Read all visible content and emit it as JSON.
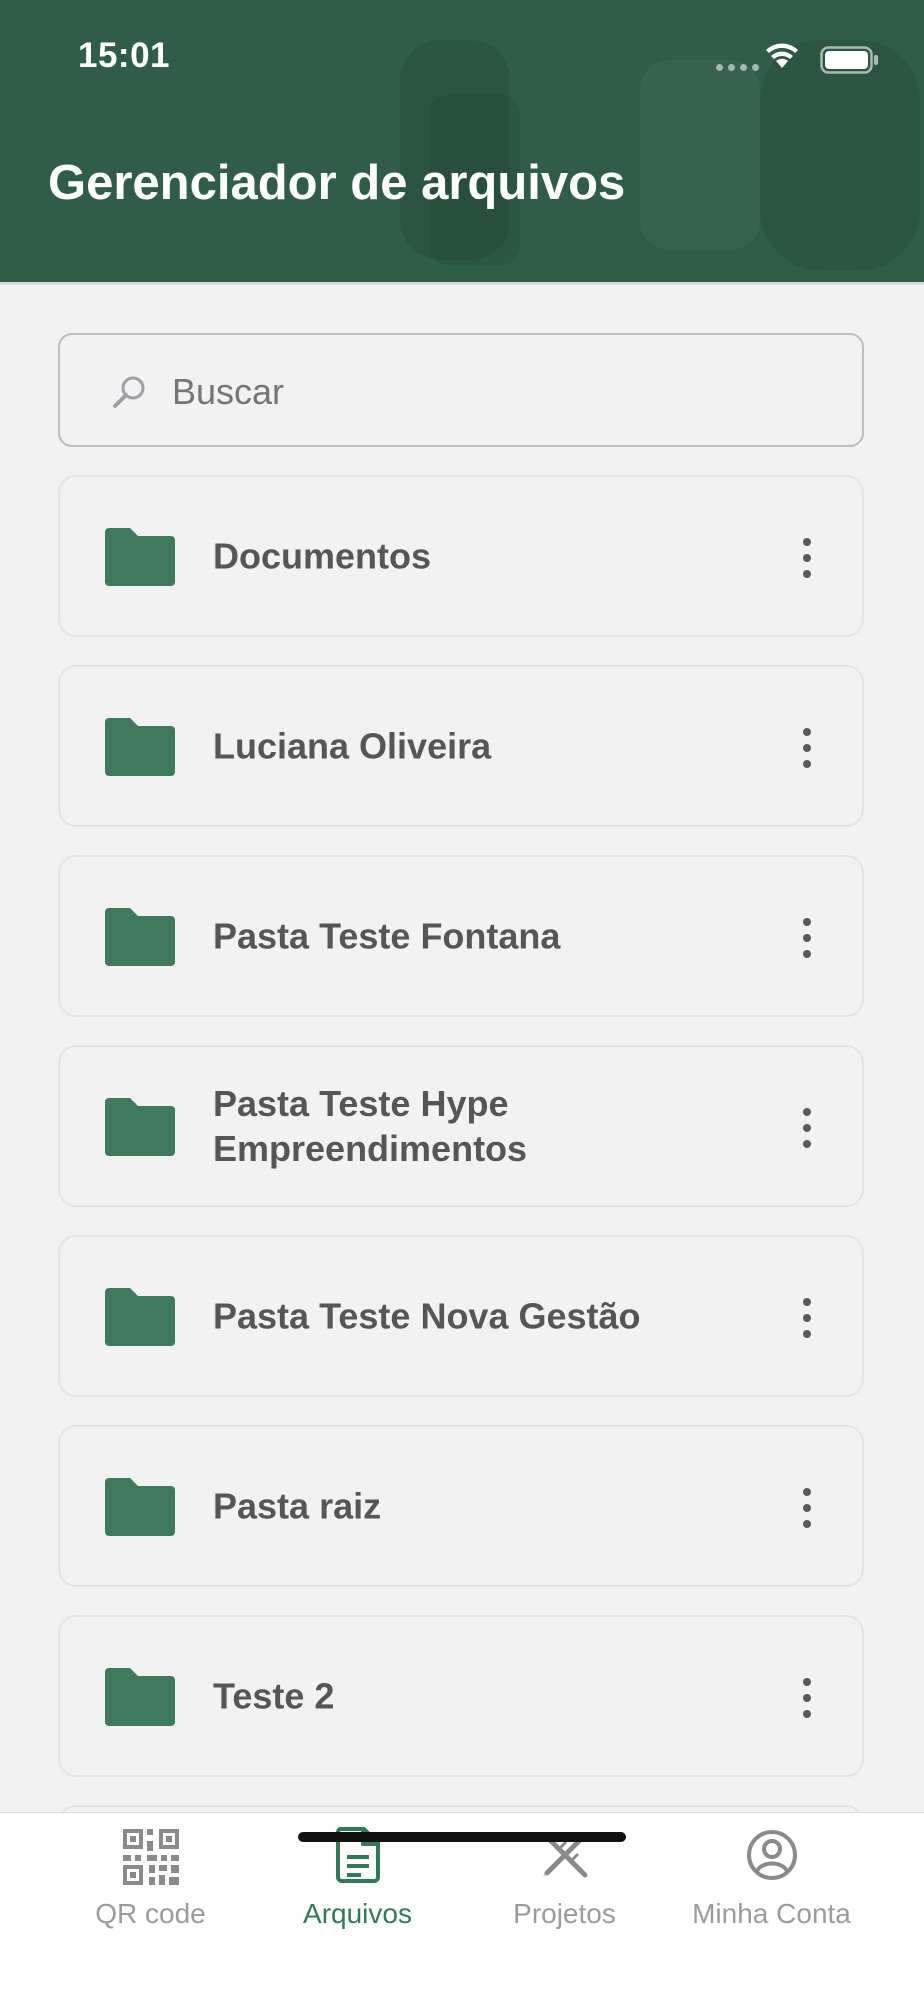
{
  "status_bar": {
    "time": "15:01"
  },
  "header": {
    "title": "Gerenciador de arquivos"
  },
  "search": {
    "placeholder": "Buscar",
    "value": ""
  },
  "folders": [
    {
      "name": "Documentos"
    },
    {
      "name": "Luciana Oliveira"
    },
    {
      "name": "Pasta Teste Fontana"
    },
    {
      "name": "Pasta Teste Hype Empreendimentos"
    },
    {
      "name": "Pasta Teste Nova Gestão"
    },
    {
      "name": "Pasta raiz"
    },
    {
      "name": "Teste 2"
    }
  ],
  "tabs": [
    {
      "label": "QR code",
      "icon": "qr-code-icon",
      "active": false
    },
    {
      "label": "Arquivos",
      "icon": "document-icon",
      "active": true
    },
    {
      "label": "Projetos",
      "icon": "design-tools-icon",
      "active": false
    },
    {
      "label": "Minha Conta",
      "icon": "account-circle-icon",
      "active": false
    }
  ],
  "colors": {
    "header_bg": "#2f5d47",
    "folder": "#3f7a5e",
    "accent": "#2f7a58",
    "inactive_tab": "#9b9b9b"
  }
}
